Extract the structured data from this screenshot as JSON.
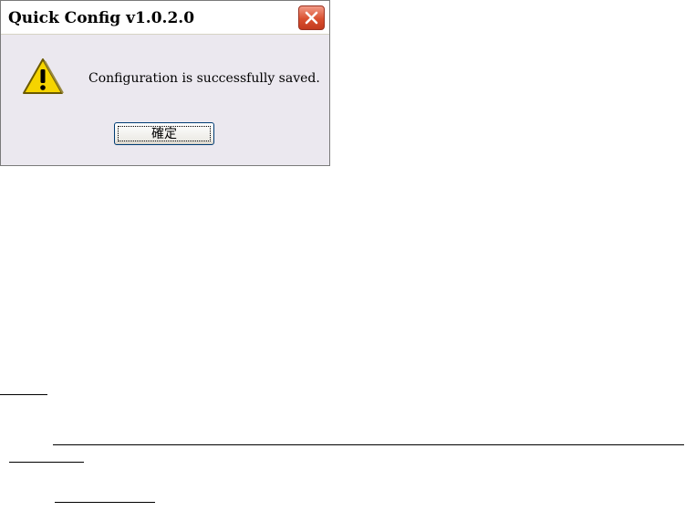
{
  "dialog": {
    "title": "Quick Config v1.0.2.0",
    "message": "Configuration is successfully saved.",
    "ok_label": "確定",
    "icons": {
      "warning": "warning-icon",
      "close": "close-icon"
    }
  },
  "colors": {
    "dialog_background": "#ebe8ef",
    "close_button": "#d9502f",
    "warning_fill": "#f5d400"
  }
}
